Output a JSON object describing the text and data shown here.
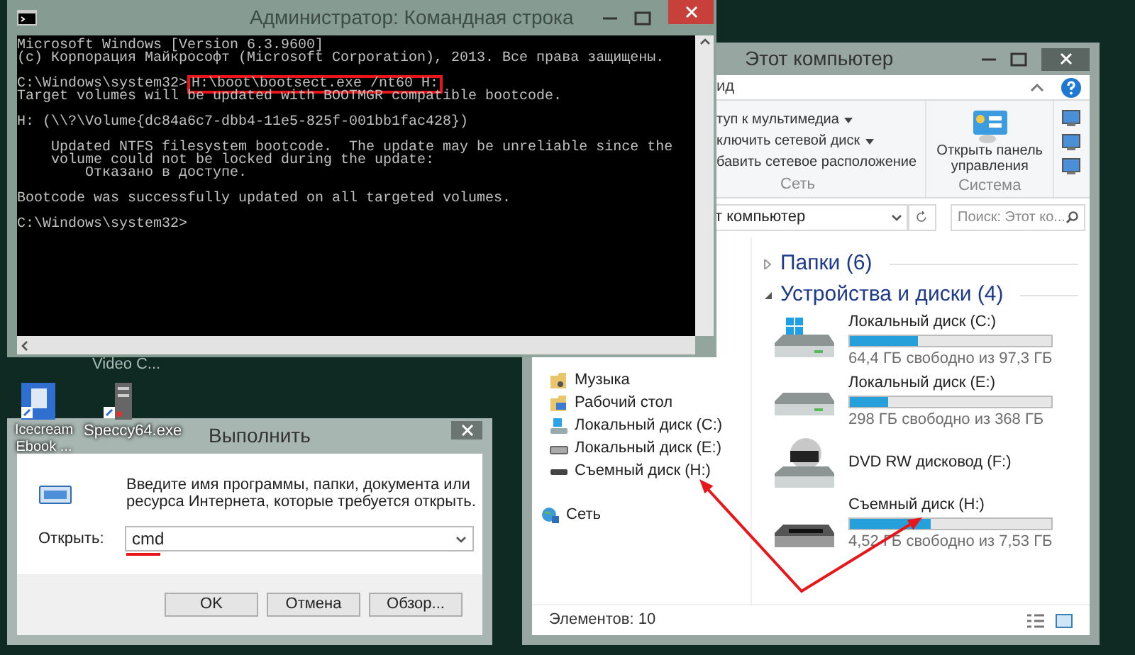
{
  "desktop_icons": [
    {
      "label": "Video C..."
    },
    {
      "label": "Icecream Ebook ...",
      "kind": "book"
    },
    {
      "label": "Speccy64.exe",
      "kind": "server"
    }
  ],
  "cmd_window": {
    "title": "Администратор: Командная строка",
    "blocks": [
      {
        "lines": [
          {
            "kind": "output",
            "text": "Microsoft Windows [Version 6.3.9600]"
          },
          {
            "kind": "output",
            "text": "(c) Корпорация Майкрософт (Microsoft Corporation), 2013. Все права защищены."
          }
        ]
      },
      {
        "lines": [
          {
            "kind": "command",
            "prompt": "C:\\Windows\\system32>",
            "command": "H:\\boot\\bootsect.exe /nt60 H:",
            "highlighted": true
          },
          {
            "kind": "output",
            "text": "Target volumes will be updated with BOOTMGR compatible bootcode."
          }
        ]
      },
      {
        "lines": [
          {
            "kind": "output",
            "text": "H: (\\\\?\\Volume{dc84a6c7-dbb4-11e5-825f-001bb1fac428})"
          }
        ]
      },
      {
        "lines": [
          {
            "kind": "output",
            "text": "    Updated NTFS filesystem bootcode.  The update may be unreliable since the"
          },
          {
            "kind": "output",
            "text": "    volume could not be locked during the update:"
          },
          {
            "kind": "output",
            "text": "        Отказано в доступе."
          }
        ]
      },
      {
        "lines": [
          {
            "kind": "output",
            "text": "Bootcode was successfully updated on all targeted volumes."
          }
        ]
      },
      {
        "lines": [
          {
            "kind": "output",
            "text": "C:\\Windows\\system32>"
          }
        ]
      }
    ]
  },
  "explorer": {
    "title": "Этот компьютер",
    "ribbon_tab": "ид",
    "ribbon_groups": [
      {
        "kind": "list",
        "label": "Сеть",
        "items": [
          {
            "label": "туп к мультимедиа",
            "dropdown": true
          },
          {
            "label": "ключить сетевой диск",
            "dropdown": true
          },
          {
            "label": "бавить сетевое расположение",
            "dropdown": false
          }
        ]
      },
      {
        "kind": "large_button",
        "label": "Система",
        "button": "Открыть панель управления"
      }
    ],
    "address": "т компьютер",
    "search": {
      "placeholder": "Поиск: Этот ко..."
    },
    "nav_items": [
      {
        "label": "Музыка",
        "kind": "music"
      },
      {
        "label": "Рабочий стол",
        "kind": "desktop"
      },
      {
        "label": "Локальный диск (C:)",
        "kind": "system_drive"
      },
      {
        "label": "Локальный диск (E:)",
        "kind": "drive"
      },
      {
        "label": "Съемный диск (H:)",
        "kind": "removable"
      },
      {
        "label": "Сеть",
        "kind": "network"
      }
    ],
    "sections": [
      {
        "title": "Папки (6)",
        "expanded": false
      },
      {
        "title": "Устройства и диски (4)",
        "expanded": true,
        "devices": [
          {
            "kind": "system_drive",
            "name": "Локальный диск (C:)",
            "level": 0.34,
            "free": "64,4 ГБ свободно из 97,3 ГБ"
          },
          {
            "kind": "drive",
            "name": "Локальный диск (E:)",
            "level": 0.19,
            "free": "298 ГБ свободно из 368 ГБ"
          },
          {
            "kind": "dvd",
            "name": "DVD RW дисковод (F:)"
          },
          {
            "kind": "removable",
            "name": "Съемный диск (H:)",
            "level": 0.4,
            "free": "4,52 ГБ свободно из 7,53 ГБ"
          }
        ]
      }
    ],
    "status": "Элементов: 10"
  },
  "run_dialog": {
    "title": "Выполнить",
    "description": "Введите имя программы, папки, документа или ресурса Интернета, которые требуется открыть.",
    "open_label": "Открыть:",
    "value": "cmd",
    "underlined": true,
    "buttons": [
      "OK",
      "Отмена",
      "Обзор..."
    ]
  }
}
